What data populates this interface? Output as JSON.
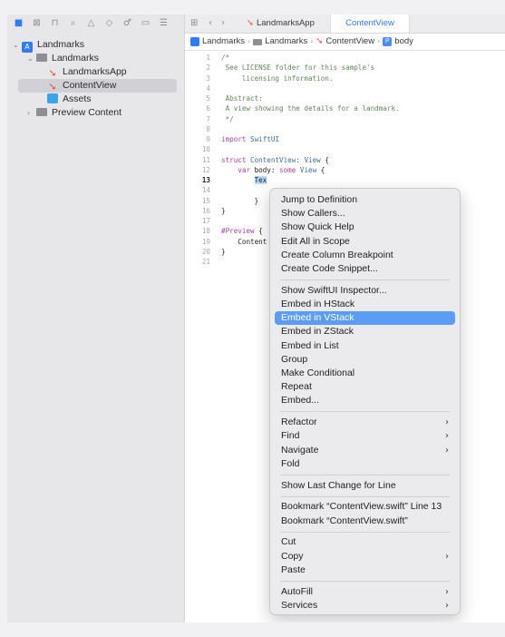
{
  "navigator": {
    "toolbar_icons": [
      "folder-icon",
      "x-square-icon",
      "bookmark-icon",
      "search-icon",
      "warning-icon",
      "diamond-icon",
      "tag-icon",
      "rectangle-icon",
      "list-icon"
    ],
    "items": [
      {
        "label": "Landmarks",
        "chev": "⌄"
      },
      {
        "label": "Landmarks",
        "chev": "⌄"
      },
      {
        "label": "LandmarksApp",
        "chev": ""
      },
      {
        "label": "ContentView",
        "chev": ""
      },
      {
        "label": "Assets",
        "chev": ""
      },
      {
        "label": "Preview Content",
        "chev": "›"
      }
    ]
  },
  "editor": {
    "tabs": [
      {
        "label": "LandmarksApp"
      },
      {
        "label": "ContentView"
      }
    ],
    "jumpbar": {
      "project": "Landmarks",
      "folder": "Landmarks",
      "file": "ContentView",
      "symbol_badge": "P",
      "symbol": "body"
    },
    "current_line": "13",
    "code_lines": [
      {
        "n": "1",
        "t": "/*"
      },
      {
        "n": "2",
        "t": " See LICENSE folder for this sample's"
      },
      {
        "n": "3",
        "t": "     licensing information."
      },
      {
        "n": "4",
        "t": ""
      },
      {
        "n": "5",
        "t": " Abstract:"
      },
      {
        "n": "6",
        "t": " A view showing the details for a landmark."
      },
      {
        "n": "7",
        "t": " */"
      },
      {
        "n": "8",
        "t": ""
      },
      {
        "n": "9",
        "t": "import SwiftUI"
      },
      {
        "n": "10",
        "t": ""
      },
      {
        "n": "11",
        "t": "struct ContentView: View {"
      },
      {
        "n": "12",
        "t": "    var body: some View {"
      },
      {
        "n": "13",
        "t": "        Tex"
      },
      {
        "n": "14",
        "t": ""
      },
      {
        "n": "15",
        "t": "        }"
      },
      {
        "n": "16",
        "t": "}"
      },
      {
        "n": "17",
        "t": ""
      },
      {
        "n": "18",
        "t": "#Preview {"
      },
      {
        "n": "19",
        "t": "    Content"
      },
      {
        "n": "20",
        "t": "}"
      },
      {
        "n": "21",
        "t": ""
      }
    ]
  },
  "context_menu": {
    "highlighted": "Embed in VStack",
    "groups": [
      [
        "Jump to Definition",
        "Show Callers...",
        "Show Quick Help",
        "Edit All in Scope",
        "Create Column Breakpoint",
        "Create Code Snippet..."
      ],
      [
        "Show SwiftUI Inspector...",
        "Embed in HStack",
        "Embed in VStack",
        "Embed in ZStack",
        "Embed in List",
        "Group",
        "Make Conditional",
        "Repeat",
        "Embed..."
      ],
      [
        "Refactor",
        "Find",
        "Navigate",
        "Fold"
      ],
      [
        "Show Last Change for Line"
      ],
      [
        "Bookmark “ContentView.swift” Line 13",
        "Bookmark “ContentView.swift”"
      ],
      [
        "Cut",
        "Copy",
        "Paste"
      ],
      [
        "AutoFill",
        "Services"
      ]
    ],
    "submenu_items": [
      "Refactor",
      "Find",
      "Navigate",
      "Copy",
      "AutoFill",
      "Services"
    ]
  }
}
